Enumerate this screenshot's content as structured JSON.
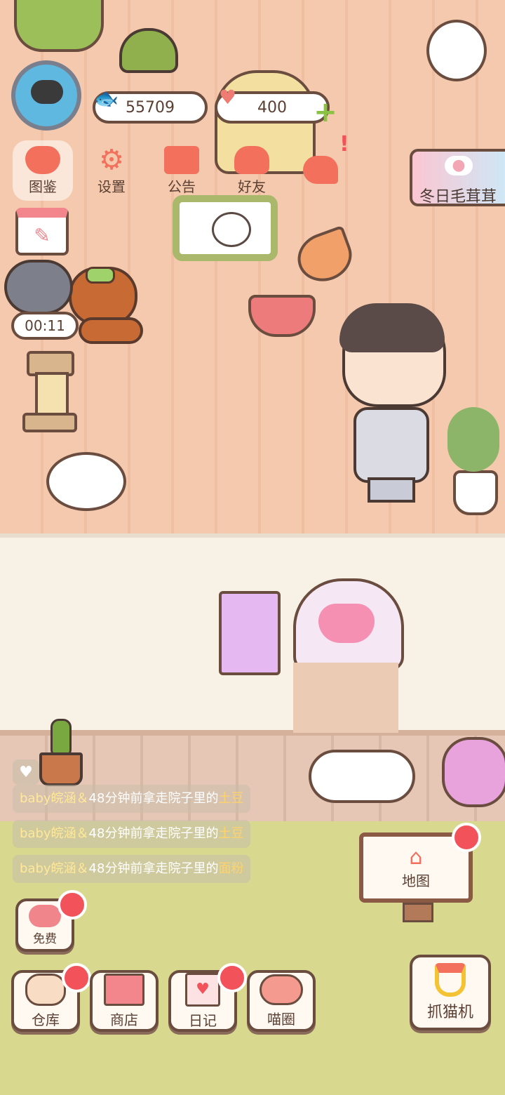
{
  "hud": {
    "fish_count": "55709",
    "heart_count": "400",
    "timer": "00:11"
  },
  "menu": [
    {
      "id": "tujian",
      "label": "图鉴"
    },
    {
      "id": "settings",
      "label": "设置"
    },
    {
      "id": "announcement",
      "label": "公告"
    },
    {
      "id": "friends",
      "label": "好友"
    },
    {
      "id": "message",
      "label": ""
    }
  ],
  "event_banner": {
    "label": "冬日毛茸茸"
  },
  "feed": [
    {
      "user": "baby皖涵＆",
      "text": "48分钟前拿走院子里的",
      "item": "土豆"
    },
    {
      "user": "baby皖涵＆",
      "text": "48分钟前拿走院子里的",
      "item": "土豆"
    },
    {
      "user": "baby皖涵＆",
      "text": "48分钟前拿走院子里的",
      "item": "面粉"
    }
  ],
  "map_sign": {
    "label": "地图"
  },
  "free_button": {
    "label": "免费"
  },
  "bottom_bar": [
    {
      "id": "warehouse",
      "label": "仓库"
    },
    {
      "id": "shop",
      "label": "商店"
    },
    {
      "id": "diary",
      "label": "日记"
    },
    {
      "id": "meow-circle",
      "label": "喵圈"
    }
  ],
  "claw_machine": {
    "label": "抓猫机"
  },
  "colors": {
    "accent": "#f2535b",
    "outline": "#6a4d3f",
    "grass": "#d8d98e",
    "floor": "#f5c9ad"
  }
}
